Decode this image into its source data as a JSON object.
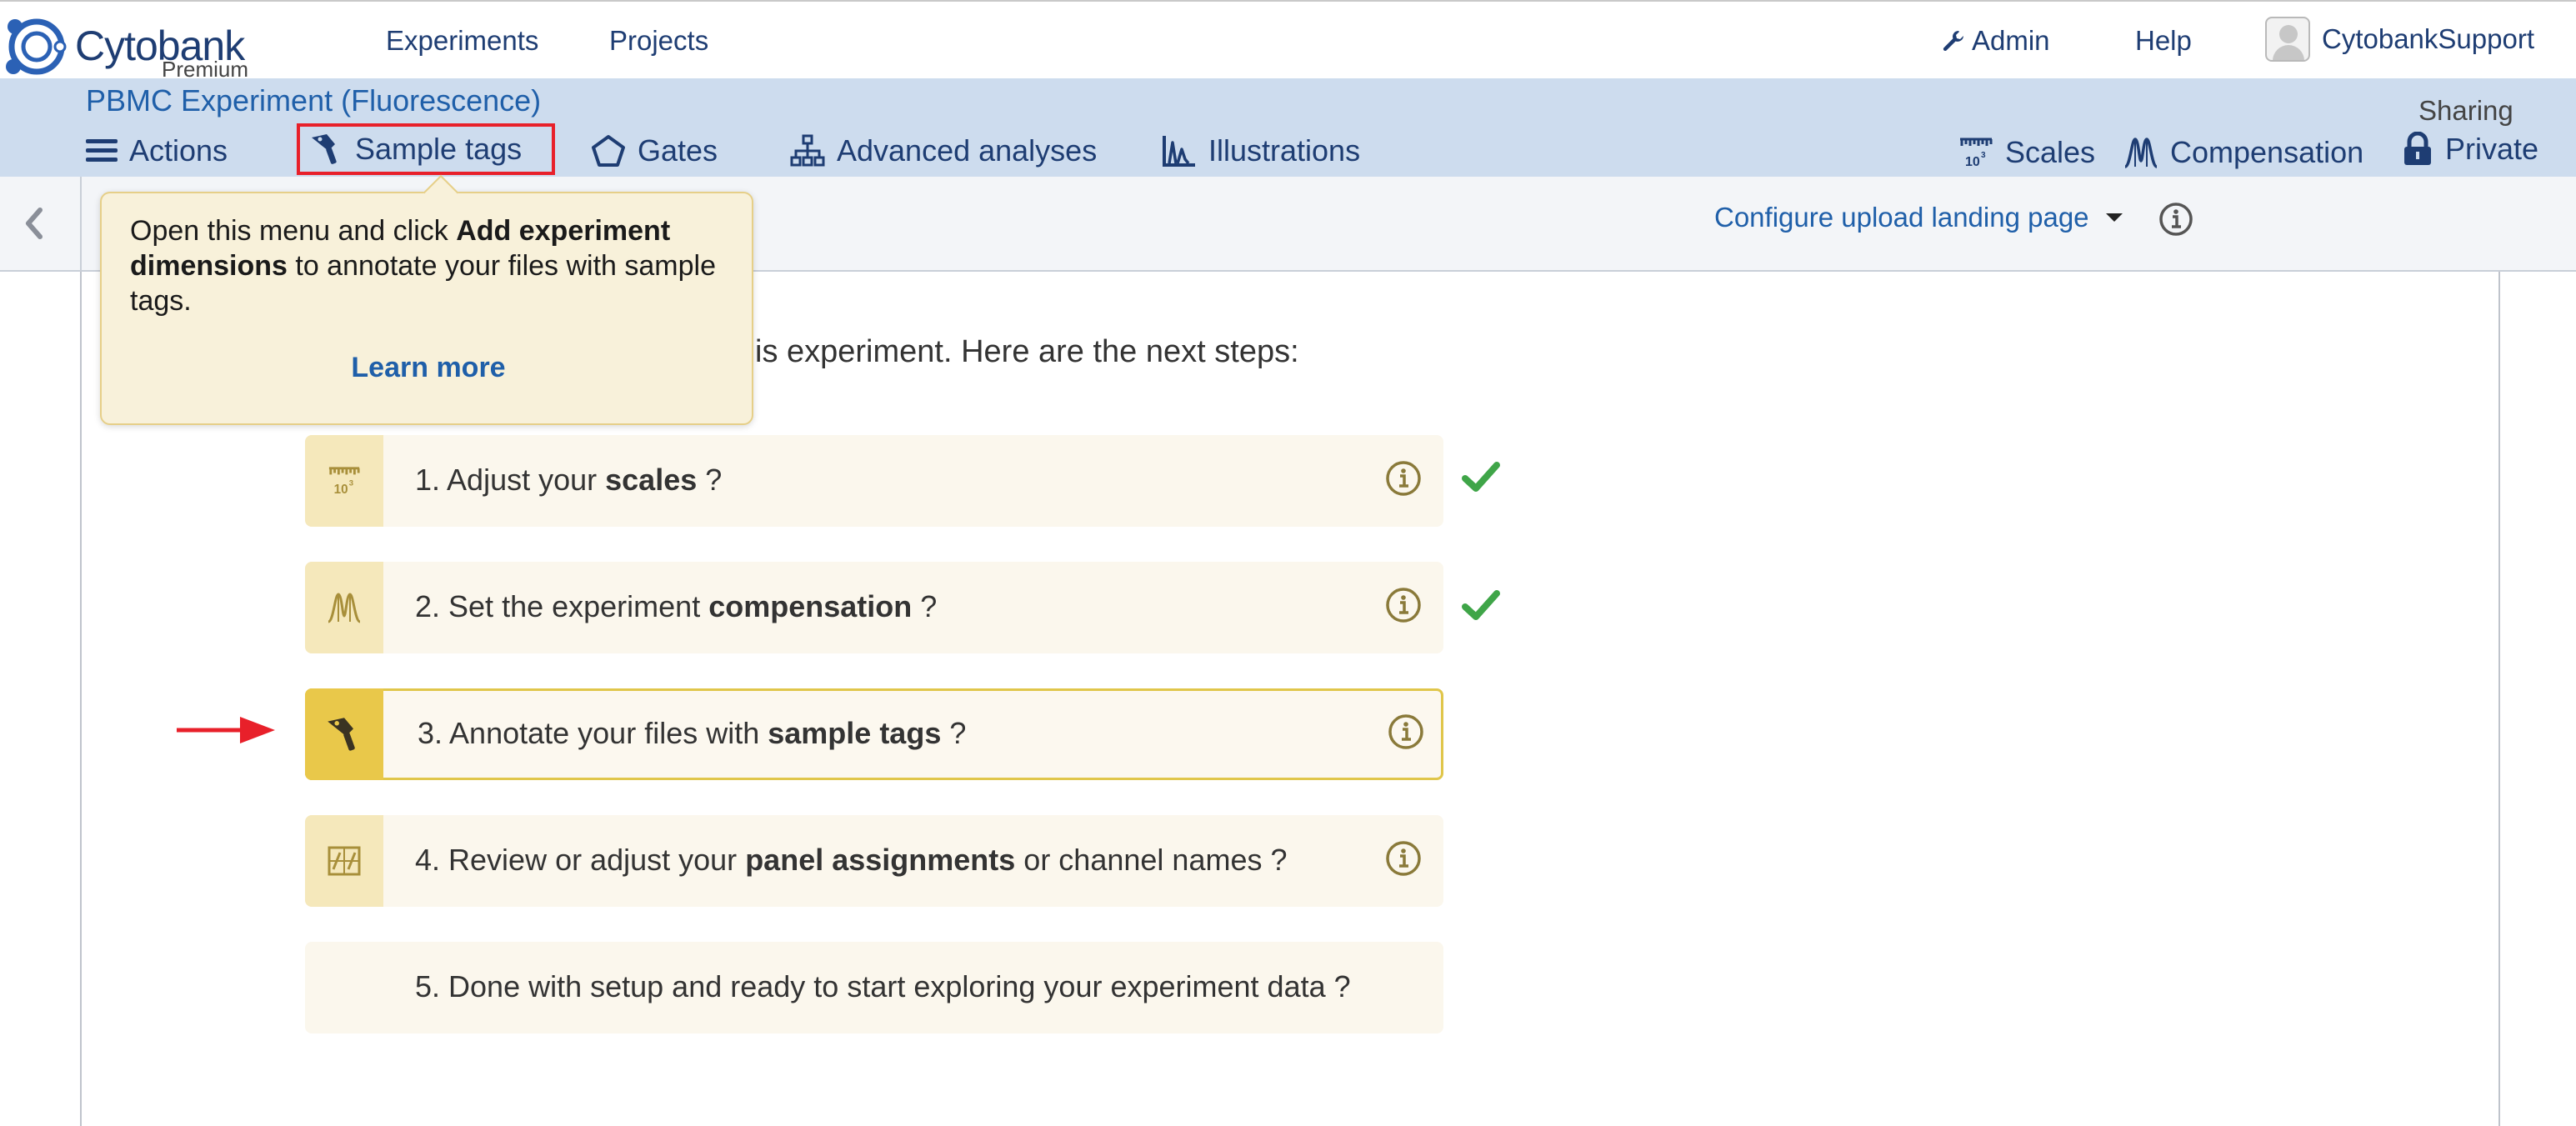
{
  "topnav": {
    "logo_text": "Cytobank",
    "logo_sub": "Premium",
    "experiments": "Experiments",
    "projects": "Projects",
    "admin": "Admin",
    "help": "Help",
    "user": "CytobankSupport"
  },
  "experiment": {
    "title": "PBMC Experiment (Fluorescence)",
    "toolbar": {
      "actions": "Actions",
      "sample_tags": "Sample tags",
      "gates": "Gates",
      "advanced_analyses": "Advanced analyses",
      "illustrations": "Illustrations",
      "scales": "Scales",
      "compensation": "Compensation",
      "sharing_label": "Sharing",
      "sharing_value": "Private"
    }
  },
  "subbar": {
    "configure": "Configure upload landing page"
  },
  "tooltip": {
    "text_1": "Open this menu and click ",
    "text_bold": "Add experiment dimensions",
    "text_2": " to annotate your files with sample tags.",
    "learn_more": "Learn more"
  },
  "intro": "is experiment. Here are the next steps:",
  "steps": [
    {
      "prefix": "1. Adjust your ",
      "bold": "scales",
      "suffix": " ?",
      "icon": "scales-icon",
      "done": true
    },
    {
      "prefix": "2. Set the experiment ",
      "bold": "compensation",
      "suffix": " ?",
      "icon": "compensation-icon",
      "done": true
    },
    {
      "prefix": "3. Annotate your files with ",
      "bold": "sample tags",
      "suffix": " ?",
      "icon": "sample-tag-icon",
      "done": false,
      "active": true
    },
    {
      "prefix": "4. Review or adjust your ",
      "bold": "panel assignments",
      "suffix": " or channel names ?",
      "icon": "panel-icon",
      "done": false
    },
    {
      "prefix": "5. Done with setup and ready to start exploring your experiment data ?",
      "bold": "",
      "suffix": "",
      "icon": "",
      "done": false
    }
  ],
  "colors": {
    "nav_blue": "#1e3d73",
    "link_blue": "#1f5fa9",
    "header_bg": "#cddcee",
    "step_bg": "#fbf7ed",
    "step_icon_bg": "#f5e8bb",
    "active_icon_bg": "#e9c84a",
    "highlight_red": "#e8202a",
    "check_green": "#3fa548"
  }
}
